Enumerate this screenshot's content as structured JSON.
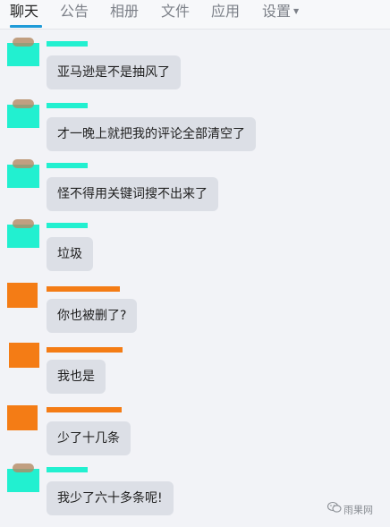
{
  "tabs": [
    {
      "label": "聊天",
      "active": true
    },
    {
      "label": "公告",
      "active": false
    },
    {
      "label": "相册",
      "active": false
    },
    {
      "label": "文件",
      "active": false
    },
    {
      "label": "应用",
      "active": false
    },
    {
      "label": "设置",
      "active": false,
      "has_dropdown": true
    }
  ],
  "messages": [
    {
      "text": "亚马逊是不是抽风了",
      "sender_mask_color": "#22f0d0"
    },
    {
      "text": "才一晚上就把我的评论全部清空了",
      "sender_mask_color": "#22f0d0"
    },
    {
      "text": "怪不得用关键词搜不出来了",
      "sender_mask_color": "#22f0d0"
    },
    {
      "text": "垃圾",
      "sender_mask_color": "#22f0d0"
    },
    {
      "text": "你也被删了?",
      "sender_mask_color": "#f47c15"
    },
    {
      "text": "我也是",
      "sender_mask_color": "#f47c15"
    },
    {
      "text": "少了十几条",
      "sender_mask_color": "#f47c15"
    },
    {
      "text": "我少了六十多条呢!",
      "sender_mask_color": "#22f0d0"
    }
  ],
  "watermark": {
    "text": "雨果网",
    "icon": "wechat-icon"
  },
  "colors": {
    "accent": "#1f9bd8",
    "bubble": "#dcdfe6",
    "background": "#f2f3f7"
  }
}
